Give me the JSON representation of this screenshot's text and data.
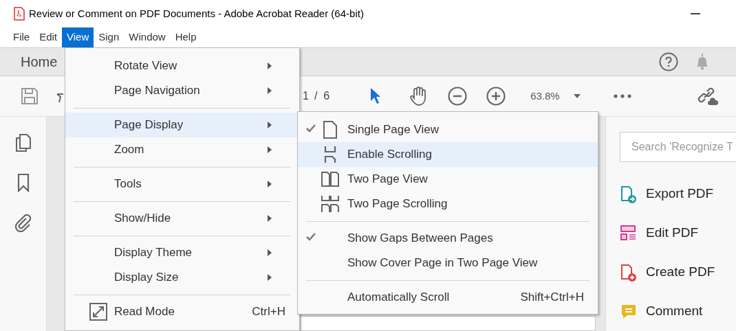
{
  "window": {
    "title": "Review or Comment on PDF Documents - Adobe Acrobat Reader (64-bit)"
  },
  "menubar": [
    {
      "label": "File",
      "selected": false
    },
    {
      "label": "Edit",
      "selected": false
    },
    {
      "label": "View",
      "selected": true
    },
    {
      "label": "Sign",
      "selected": false
    },
    {
      "label": "Window",
      "selected": false
    },
    {
      "label": "Help",
      "selected": false
    }
  ],
  "home_tab": "Home",
  "toolbar": {
    "page_current": "1",
    "page_total": "/  6",
    "zoom": "63.8%"
  },
  "right_panel": {
    "search": {
      "placeholder": "Search 'Recognize T"
    },
    "tools": [
      {
        "label": "Export PDF",
        "kind": "export"
      },
      {
        "label": "Edit PDF",
        "kind": "edit"
      },
      {
        "label": "Create PDF",
        "kind": "create"
      },
      {
        "label": "Comment",
        "kind": "comment"
      }
    ]
  },
  "view_menu": [
    {
      "kind": "item",
      "label": "Rotate View",
      "submenu": true,
      "highlighted": false
    },
    {
      "kind": "item",
      "label": "Page Navigation",
      "submenu": true,
      "highlighted": false
    },
    {
      "kind": "separator"
    },
    {
      "kind": "item",
      "label": "Page Display",
      "submenu": true,
      "highlighted": true
    },
    {
      "kind": "item",
      "label": "Zoom",
      "submenu": true,
      "highlighted": false
    },
    {
      "kind": "separator"
    },
    {
      "kind": "item",
      "label": "Tools",
      "submenu": true,
      "highlighted": false
    },
    {
      "kind": "separator"
    },
    {
      "kind": "item",
      "label": "Show/Hide",
      "submenu": true,
      "highlighted": false
    },
    {
      "kind": "separator"
    },
    {
      "kind": "item",
      "label": "Display Theme",
      "submenu": true,
      "highlighted": false
    },
    {
      "kind": "item",
      "label": "Display Size",
      "submenu": true,
      "highlighted": false
    },
    {
      "kind": "separator"
    },
    {
      "kind": "read-mode",
      "label": "Read Mode",
      "submenu": false,
      "highlighted": false,
      "shortcut": "Ctrl+H"
    }
  ],
  "page_display_submenu": [
    {
      "kind": "single-page",
      "label": "Single Page View",
      "checked": true,
      "highlighted": false
    },
    {
      "kind": "scroll",
      "label": "Enable Scrolling",
      "checked": false,
      "highlighted": true
    },
    {
      "kind": "two-page",
      "label": "Two Page View",
      "checked": false,
      "highlighted": false
    },
    {
      "kind": "two-page-scroll",
      "label": "Two Page Scrolling",
      "checked": false,
      "highlighted": false
    },
    {
      "kind": "separator"
    },
    {
      "kind": "item",
      "label": "Show Gaps Between Pages",
      "checked": true,
      "highlighted": false
    },
    {
      "kind": "item",
      "label": "Show Cover Page in Two Page View",
      "checked": false,
      "highlighted": false
    },
    {
      "kind": "separator"
    },
    {
      "kind": "item",
      "label": "Automatically Scroll",
      "checked": false,
      "highlighted": false,
      "shortcut": "Shift+Ctrl+H"
    }
  ]
}
